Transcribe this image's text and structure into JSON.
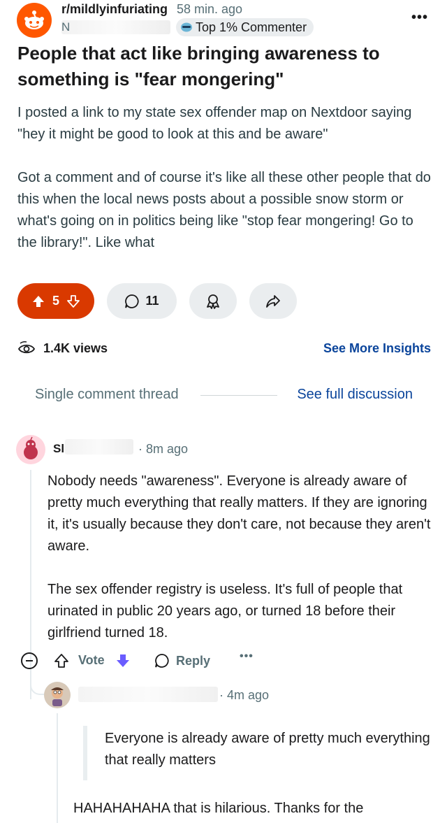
{
  "post": {
    "subreddit": "r/mildlyinfuriating",
    "time": "58 min. ago",
    "author_visible": "N",
    "badge": "Top 1% Commenter",
    "title": "People that act like bringing awareness to something is \"fear mongering\"",
    "body": [
      "I posted a link to my state sex offender map on Nextdoor saying \"hey it might be good to look at this and be aware\"",
      "Got a comment and of course it's like all these other people that do this when the local news posts about a possible snow storm or what's going on in politics being like \"stop fear mongering! Go to the library!\". Like what"
    ],
    "vote_count": "5",
    "comment_count": "11",
    "views": "1.4K views",
    "insights_link": "See More Insights"
  },
  "thread": {
    "label": "Single comment thread",
    "full_link": "See full discussion"
  },
  "comment1": {
    "author_visible": "Sl",
    "time": "· 8m ago",
    "body": [
      "Nobody needs \"awareness\". Everyone is already aware of pretty much everything that really matters. If they are ignoring it, it's usually because they don't care, not because they aren't aware.",
      "The sex offender registry is useless. It's full of people that urinated in public 20 years ago, or turned 18 before their girlfriend turned 18."
    ],
    "vote_label": "Vote",
    "reply_label": "Reply",
    "more_label": "•••"
  },
  "comment2": {
    "time": "· 4m ago",
    "quote": "Everyone is already aware of pretty much everything that really matters",
    "body": "HAHAHAHAHA that is hilarious. Thanks for the"
  },
  "colors": {
    "upvote_active": "#d93900",
    "link_blue": "#0a449b",
    "pill_bg": "#eaedef",
    "downvote_purple": "#6a5cff"
  }
}
